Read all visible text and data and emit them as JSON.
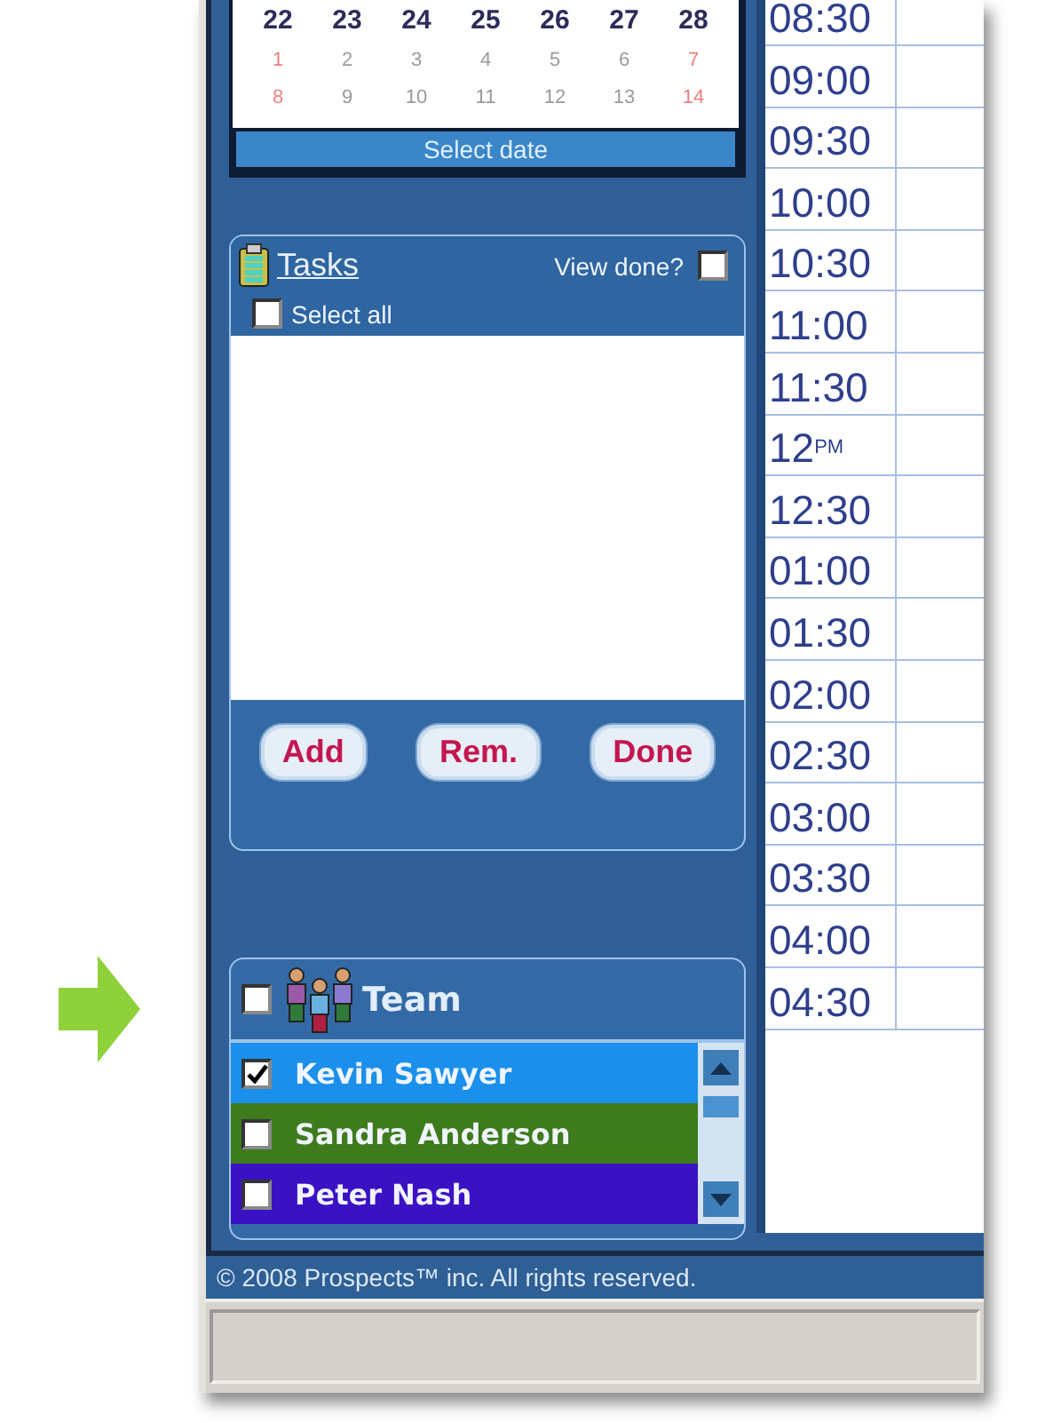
{
  "calendar": {
    "weeks": [
      [
        {
          "day": "22",
          "kind": "current"
        },
        {
          "day": "23",
          "kind": "current"
        },
        {
          "day": "24",
          "kind": "current"
        },
        {
          "day": "25",
          "kind": "current"
        },
        {
          "day": "26",
          "kind": "current"
        },
        {
          "day": "27",
          "kind": "current"
        },
        {
          "day": "28",
          "kind": "current"
        }
      ],
      [
        {
          "day": "1",
          "kind": "weekend"
        },
        {
          "day": "2",
          "kind": "other"
        },
        {
          "day": "3",
          "kind": "other"
        },
        {
          "day": "4",
          "kind": "other"
        },
        {
          "day": "5",
          "kind": "other"
        },
        {
          "day": "6",
          "kind": "other"
        },
        {
          "day": "7",
          "kind": "weekend"
        }
      ],
      [
        {
          "day": "8",
          "kind": "weekend"
        },
        {
          "day": "9",
          "kind": "other"
        },
        {
          "day": "10",
          "kind": "other"
        },
        {
          "day": "11",
          "kind": "other"
        },
        {
          "day": "12",
          "kind": "other"
        },
        {
          "day": "13",
          "kind": "other"
        },
        {
          "day": "14",
          "kind": "weekend"
        }
      ]
    ],
    "button": "Select date"
  },
  "tasks": {
    "title": "Tasks",
    "view_done": {
      "label": "View done?",
      "checked": false
    },
    "select_all": {
      "label": "Select all",
      "checked": false
    },
    "buttons": [
      "Add",
      "Rem.",
      "Done"
    ]
  },
  "team": {
    "title": "Team",
    "checked": false,
    "members": [
      {
        "name": "Kevin Sawyer",
        "checked": true,
        "color": "#1a90ec"
      },
      {
        "name": "Sandra Anderson",
        "checked": false,
        "color": "#3d7b1c"
      },
      {
        "name": "Peter Nash",
        "checked": false,
        "color": "#3a12c4"
      }
    ]
  },
  "times": [
    "08:30",
    "09:00",
    "09:30",
    "10:00",
    "10:30",
    "11:00",
    "11:30",
    "12$^{PM}$",
    "12:30",
    "01:00",
    "01:30",
    "02:00",
    "02:30",
    "03:00",
    "03:30",
    "04:00",
    "04:30"
  ],
  "footer": "© 2008 Prospects™ inc. All rights reserved."
}
